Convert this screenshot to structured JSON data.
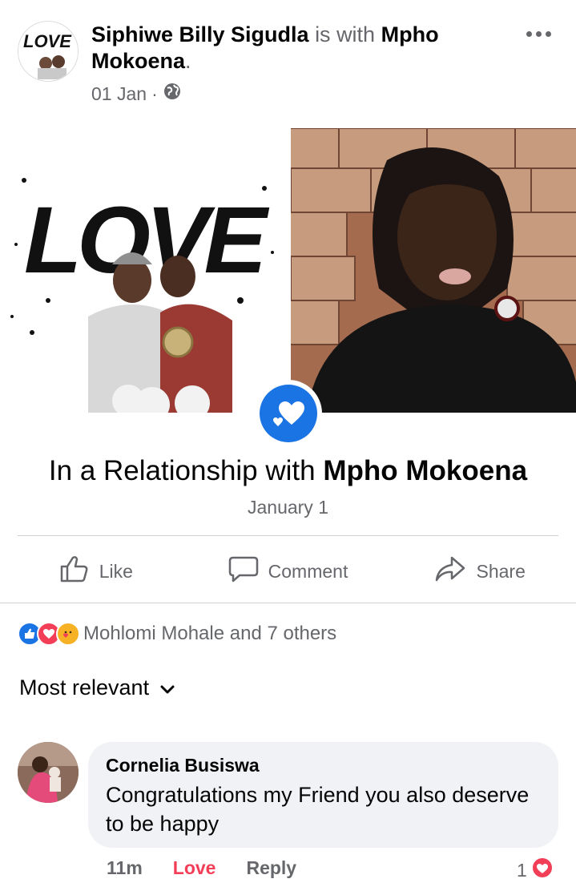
{
  "post": {
    "author": "Siphiwe Billy Sigudla",
    "with_text": "is with",
    "tagged": "Mpho Mokoena",
    "period": ".",
    "date": "01 Jan",
    "dot": "·",
    "privacy_icon": "globe-icon"
  },
  "avatar_logo_text": "LOVE",
  "life_event": {
    "prefix": "In a Relationship with",
    "name": "Mpho Mokoena",
    "date": "January 1",
    "left_photo_text": "LOVE"
  },
  "actions": {
    "like": "Like",
    "comment": "Comment",
    "share": "Share"
  },
  "reactions": {
    "summary": "Mohlomi Mohale and 7 others",
    "types": [
      "like",
      "love",
      "care"
    ]
  },
  "sort": {
    "label": "Most relevant"
  },
  "comment": {
    "name": "Cornelia Busiswa",
    "text": "Congratulations my Friend you also deserve to be happy",
    "time": "11m",
    "reaction_label": "Love",
    "reply_label": "Reply",
    "reaction_count": "1"
  },
  "colors": {
    "brand_blue": "#1b74e4",
    "love_red": "#f33e58",
    "secondary_text": "#65676b"
  }
}
